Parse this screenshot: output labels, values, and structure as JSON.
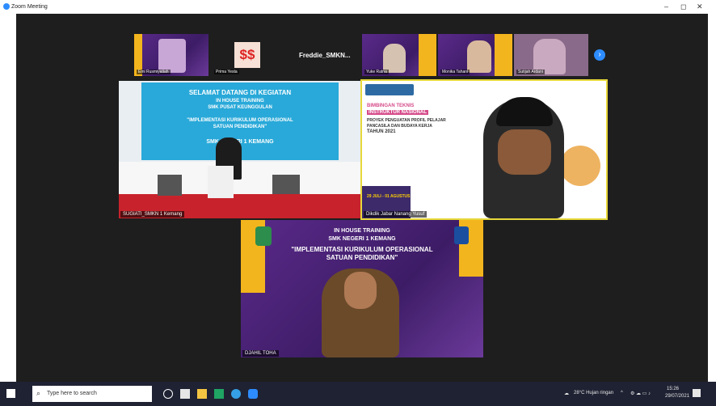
{
  "window": {
    "title": "Zoom Meeting",
    "minimize": "–",
    "restore": "◻",
    "close": "✕"
  },
  "thumbnails": [
    {
      "name": "Emi Rusmiyatiah",
      "kind": "slide"
    },
    {
      "name": "Prima Yesta",
      "kind": "logo"
    },
    {
      "name": "Freddie_SMKN...",
      "kind": "text"
    },
    {
      "name": "Yuke Ratna",
      "kind": "slide"
    },
    {
      "name": "Monika Tahani",
      "kind": "slide"
    },
    {
      "name": "Sutijah Ardani",
      "kind": "slide"
    }
  ],
  "next_page_icon": "chevron-right-icon",
  "tiles": {
    "top_left": {
      "name": "SUGIATI_SMKN 1 Kemang",
      "banner": {
        "line1": "SELAMAT DATANG DI KEGIATAN",
        "line2": "IN HOUSE TRAINING",
        "line3": "SMK PUSAT KEUNGGULAN",
        "line4": "\"IMPLEMENTASI KURIKULUM OPERASIONAL",
        "line5": "SATUAN PENDIDIKAN\"",
        "line6": "SMK NEGERI 1 KEMANG"
      }
    },
    "top_right": {
      "name": "Dikdik Jabar Nanang Yusuf",
      "slide": {
        "heading1": "BIMBINGAN TEKNIS",
        "heading2": "INSTRUKTUR NASIONAL",
        "line3": "PROYEK PENGUATAN PROFIL PELAJAR",
        "line4": "PANCASILA DAN BUDAYA KERJA",
        "line5": "TAHUN 2021",
        "dates": "29 JULI - 01 AGUSTUS"
      }
    },
    "bottom": {
      "name": "DJAHIL TOHA",
      "banner": {
        "line1": "IN HOUSE TRAINING",
        "line2": "SMK NEGERI 1 KEMANG",
        "line3": "\"IMPLEMENTASI KURIKULUM OPERASIONAL",
        "line4": "SATUAN PENDIDIKAN\""
      }
    }
  },
  "taskbar": {
    "search_placeholder": "Type here to search",
    "weather": "28°C  Hujan ringan",
    "time": "15:26",
    "date": "29/07/2021"
  }
}
